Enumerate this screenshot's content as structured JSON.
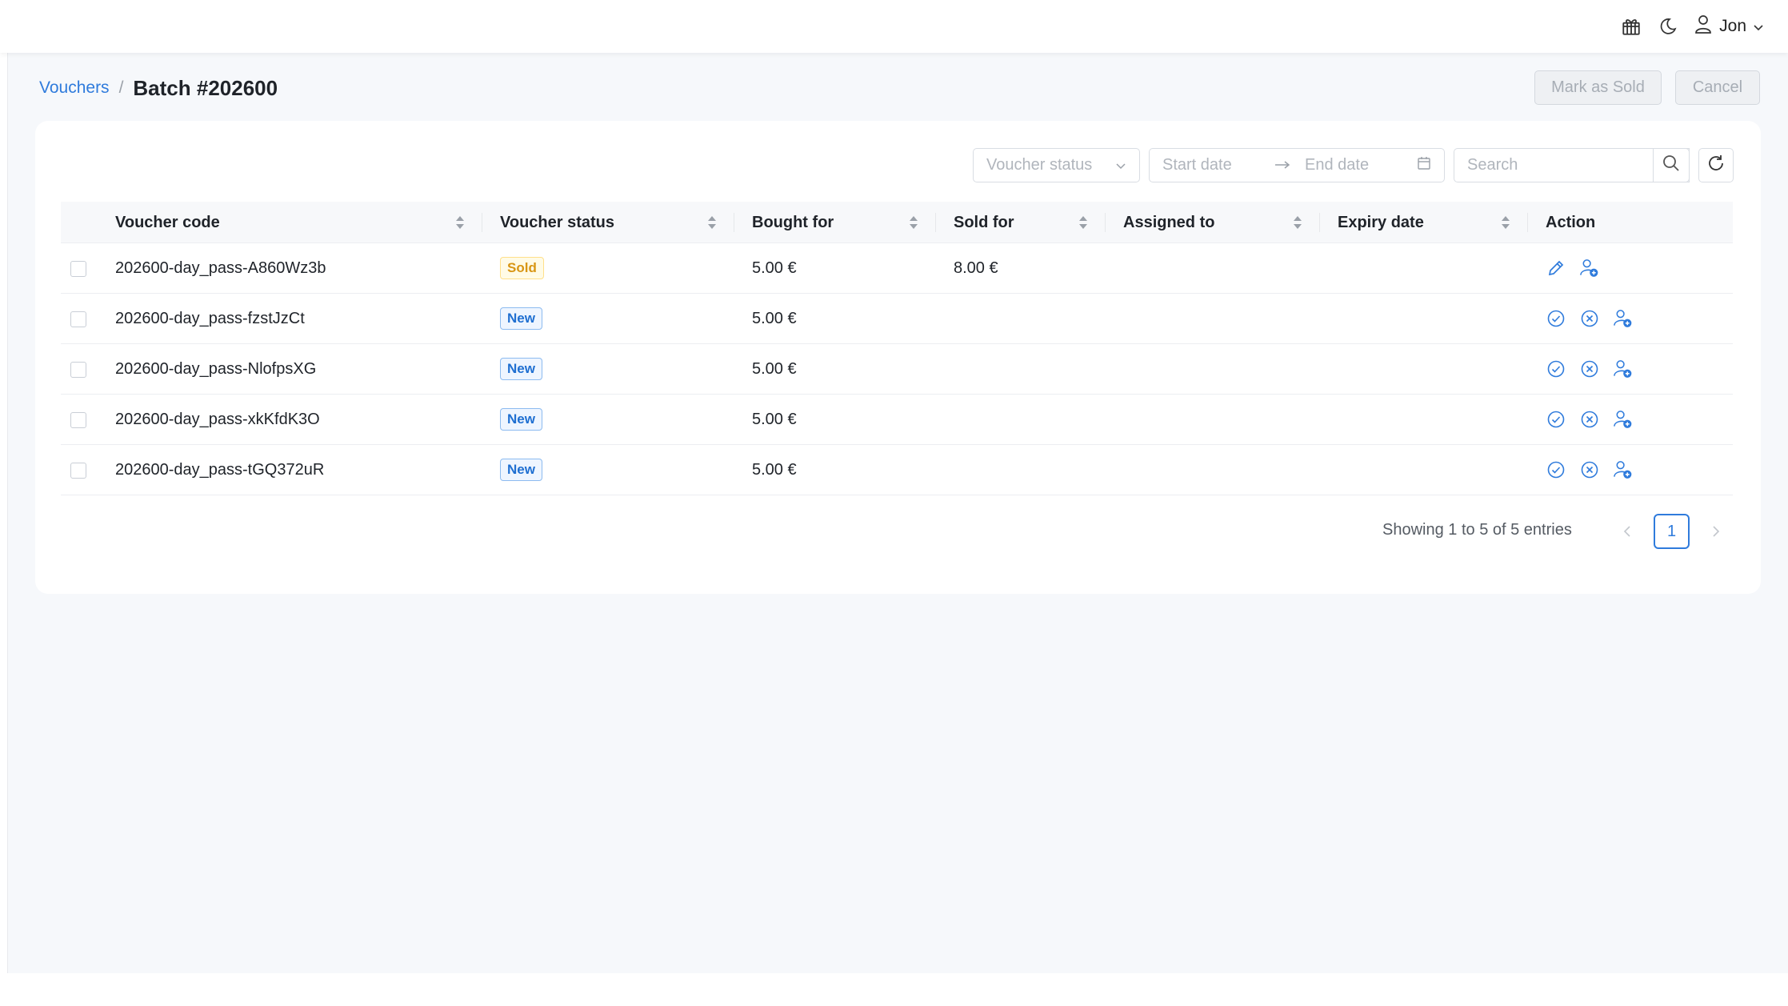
{
  "topbar": {
    "icons": [
      "gift-box-icon",
      "moon-icon",
      "user-icon",
      "chevron-down-icon"
    ],
    "user_name": "Jon"
  },
  "breadcrumb": {
    "parent": "Vouchers",
    "separator": "/",
    "current": "Batch #202600"
  },
  "header_actions": {
    "mark_as_sold": "Mark as Sold",
    "cancel": "Cancel"
  },
  "filters": {
    "status_placeholder": "Voucher status",
    "start_date_placeholder": "Start date",
    "end_date_placeholder": "End date",
    "search_placeholder": "Search"
  },
  "table": {
    "columns": [
      "Voucher code",
      "Voucher status",
      "Bought for",
      "Sold for",
      "Assigned to",
      "Expiry date",
      "Action"
    ],
    "rows": [
      {
        "code": "202600-day_pass-A860Wz3b",
        "status": "Sold",
        "bought": "5.00 €",
        "sold": "8.00 €",
        "assigned": "",
        "expiry": ""
      },
      {
        "code": "202600-day_pass-fzstJzCt",
        "status": "New",
        "bought": "5.00 €",
        "sold": "",
        "assigned": "",
        "expiry": ""
      },
      {
        "code": "202600-day_pass-NlofpsXG",
        "status": "New",
        "bought": "5.00 €",
        "sold": "",
        "assigned": "",
        "expiry": ""
      },
      {
        "code": "202600-day_pass-xkKfdK3O",
        "status": "New",
        "bought": "5.00 €",
        "sold": "",
        "assigned": "",
        "expiry": ""
      },
      {
        "code": "202600-day_pass-tGQ372uR",
        "status": "New",
        "bought": "5.00 €",
        "sold": "",
        "assigned": "",
        "expiry": ""
      }
    ]
  },
  "pagination": {
    "info": "Showing 1 to 5 of 5 entries",
    "current_page": "1"
  },
  "colors": {
    "accent": "#2f7bdc",
    "sold_badge": "#d89614",
    "new_badge": "#1f6fd1"
  }
}
